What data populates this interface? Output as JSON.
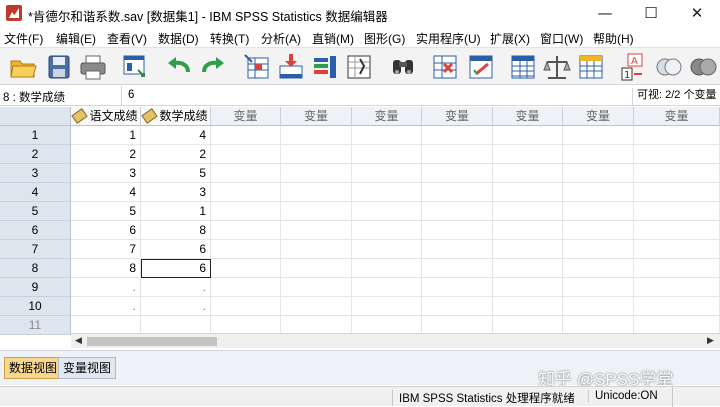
{
  "window": {
    "title": "*肯德尔和谐系数.sav [数据集1] - IBM SPSS Statistics 数据编辑器",
    "minimize_glyph": "—",
    "maximize_glyph": "☐",
    "close_glyph": "✕"
  },
  "menu": [
    "文件(F)",
    "编辑(E)",
    "查看(V)",
    "数据(D)",
    "转换(T)",
    "分析(A)",
    "直销(M)",
    "图形(G)",
    "实用程序(U)",
    "扩展(X)",
    "窗口(W)",
    "帮助(H)"
  ],
  "toolbar_icons": [
    "open-folder-icon",
    "save-icon",
    "print-icon",
    "recall-dialog-icon",
    "undo-icon",
    "redo-icon",
    "goto-case-icon",
    "goto-variable-icon",
    "variables-icon",
    "run-descriptives-icon",
    "find-icon",
    "insert-cases-icon",
    "insert-variable-icon",
    "split-file-icon",
    "weight-cases-icon",
    "select-cases-icon",
    "value-labels-icon",
    "use-sets-icon",
    "show-all-variables-icon"
  ],
  "cell_editor": {
    "reference": "8 : 数学成绩",
    "value": "6",
    "visible": "可视: 2/2 个变量"
  },
  "grid": {
    "columns": [
      "语文成绩",
      "数学成绩",
      "变量",
      "变量",
      "变量",
      "变量",
      "变量",
      "变量",
      "变量"
    ],
    "rows": [
      {
        "num": "1",
        "cells": [
          "1",
          "4"
        ]
      },
      {
        "num": "2",
        "cells": [
          "2",
          "2"
        ]
      },
      {
        "num": "3",
        "cells": [
          "3",
          "5"
        ]
      },
      {
        "num": "4",
        "cells": [
          "4",
          "3"
        ]
      },
      {
        "num": "5",
        "cells": [
          "5",
          "1"
        ]
      },
      {
        "num": "6",
        "cells": [
          "6",
          "8"
        ]
      },
      {
        "num": "7",
        "cells": [
          "7",
          "6"
        ]
      },
      {
        "num": "8",
        "cells": [
          "8",
          "6"
        ]
      },
      {
        "num": "9",
        "cells": [
          ".",
          "."
        ]
      },
      {
        "num": "10",
        "cells": [
          ".",
          "."
        ]
      },
      {
        "num": "11",
        "cells": [
          "",
          ""
        ]
      }
    ],
    "active_row": "8",
    "active_column": "数学成绩"
  },
  "tabs": {
    "data_view": "数据视图",
    "variable_view": "变量视图"
  },
  "status": {
    "processor": "IBM SPSS Statistics 处理程序就绪",
    "unicode": "Unicode:ON"
  },
  "watermark": "知乎 @SPSS学堂",
  "colors": {
    "active_tab": "#f7d68e",
    "row_header": "#dde5ef",
    "app_icon": "#c0392b"
  }
}
